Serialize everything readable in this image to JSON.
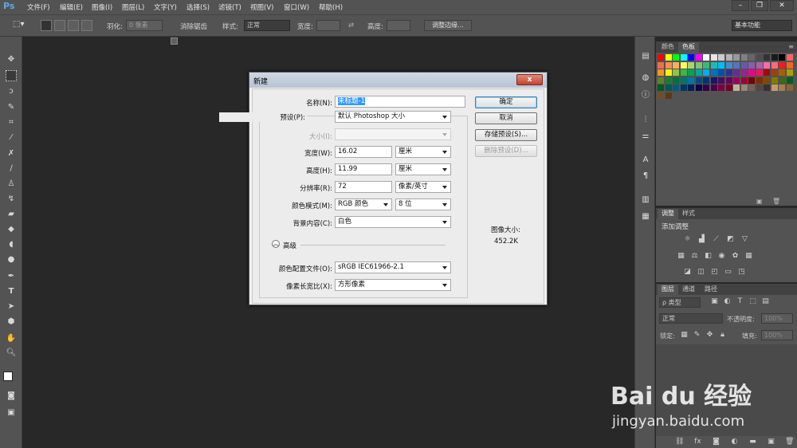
{
  "app": {
    "logo": "Ps"
  },
  "menu": [
    "文件(F)",
    "编辑(E)",
    "图像(I)",
    "图层(L)",
    "文字(Y)",
    "选择(S)",
    "滤镜(T)",
    "视图(V)",
    "窗口(W)",
    "帮助(H)"
  ],
  "window_controls": {
    "minimize": "–",
    "restore": "❐",
    "close": "✕"
  },
  "options_bar": {
    "feather_label": "羽化:",
    "feather_value": "0 像素",
    "antialias_label": "消除锯齿",
    "style_label": "样式:",
    "style_value": "正常",
    "width_label": "宽度:",
    "height_label": "高度:",
    "refine_edge_button": "调整边缘...",
    "workspace_value": "基本功能"
  },
  "dialog": {
    "title": "新建",
    "close_label": "x",
    "name_label": "名称(N):",
    "name_value": "未标题-1",
    "preset_label": "预设(P):",
    "preset_value": "默认 Photoshop 大小",
    "size_label": "大小(I):",
    "size_value": "",
    "width_label": "宽度(W):",
    "width_value": "16.02",
    "width_unit": "厘米",
    "height_label": "高度(H):",
    "height_value": "11.99",
    "height_unit": "厘米",
    "resolution_label": "分辨率(R):",
    "resolution_value": "72",
    "resolution_unit": "像素/英寸",
    "color_mode_label": "颜色模式(M):",
    "color_mode_value": "RGB 颜色",
    "bit_depth_value": "8 位",
    "background_label": "背景内容(C):",
    "background_value": "白色",
    "advanced_label": "高级",
    "color_profile_label": "颜色配置文件(O):",
    "color_profile_value": "sRGB IEC61966-2.1",
    "pixel_aspect_label": "像素长宽比(X):",
    "pixel_aspect_value": "方形像素",
    "ok_button": "确定",
    "cancel_button": "取消",
    "save_preset_button": "存储预设(S)...",
    "delete_preset_button": "删除预设(D)...",
    "image_size_label": "图像大小:",
    "image_size_value": "452.2K"
  },
  "panels": {
    "color_tabs": [
      "颜色",
      "色板"
    ],
    "adjust_tabs": [
      "调整",
      "样式"
    ],
    "adjust_title": "添加调整",
    "layers_tabs": [
      "图层",
      "通道",
      "路径"
    ],
    "layers_filter": "ρ 类型",
    "blend_mode": "正常",
    "opacity_label": "不透明度:",
    "opacity_value": "100%",
    "lock_label": "锁定:",
    "fill_label": "填充:",
    "fill_value": "100%"
  },
  "watermark": {
    "brand": "Bai du 经验",
    "url": "jingyan.baidu.com"
  }
}
